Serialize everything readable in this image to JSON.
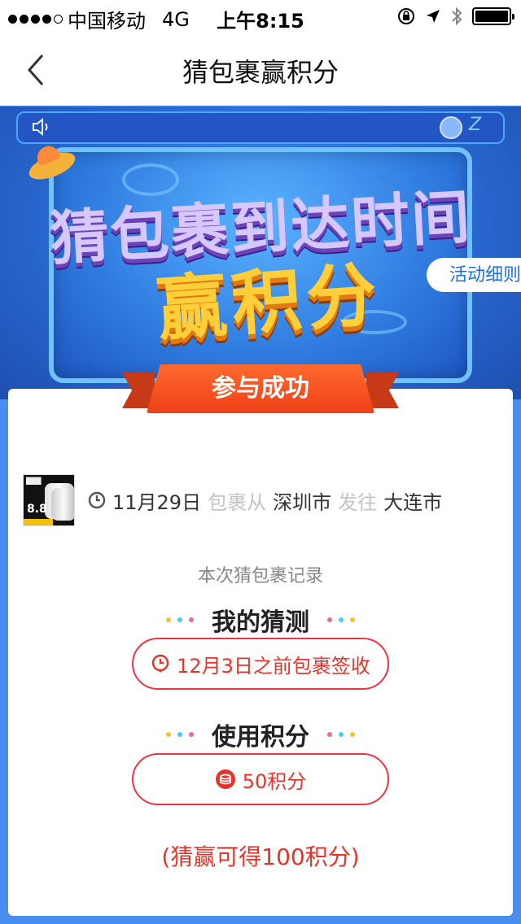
{
  "status_bar": {
    "carrier": "中国移动",
    "network": "4G",
    "time": "上午8:15"
  },
  "nav": {
    "title": "猜包裹赢积分"
  },
  "banner": {
    "headline_line1": "猜包裹到达时间",
    "headline_line2": "赢积分",
    "rules_button": "活动细则",
    "badge": "参与成功"
  },
  "package": {
    "date": "11月29日",
    "from_label": "包裹从",
    "origin": "深圳市",
    "to_label": "发往",
    "destination": "大连市",
    "thumb_price": "8.8"
  },
  "record": {
    "title": "本次猜包裹记录",
    "guess_heading": "我的猜测",
    "guess_value": "12月3日之前包裹签收",
    "points_heading": "使用积分",
    "points_value": "50积分",
    "reward_note": "(猜赢可得100积分)"
  },
  "colors": {
    "accent_red": "#e8332a",
    "primary_blue": "#1d6ee8",
    "ribbon_orange": "#ff6a2e"
  }
}
